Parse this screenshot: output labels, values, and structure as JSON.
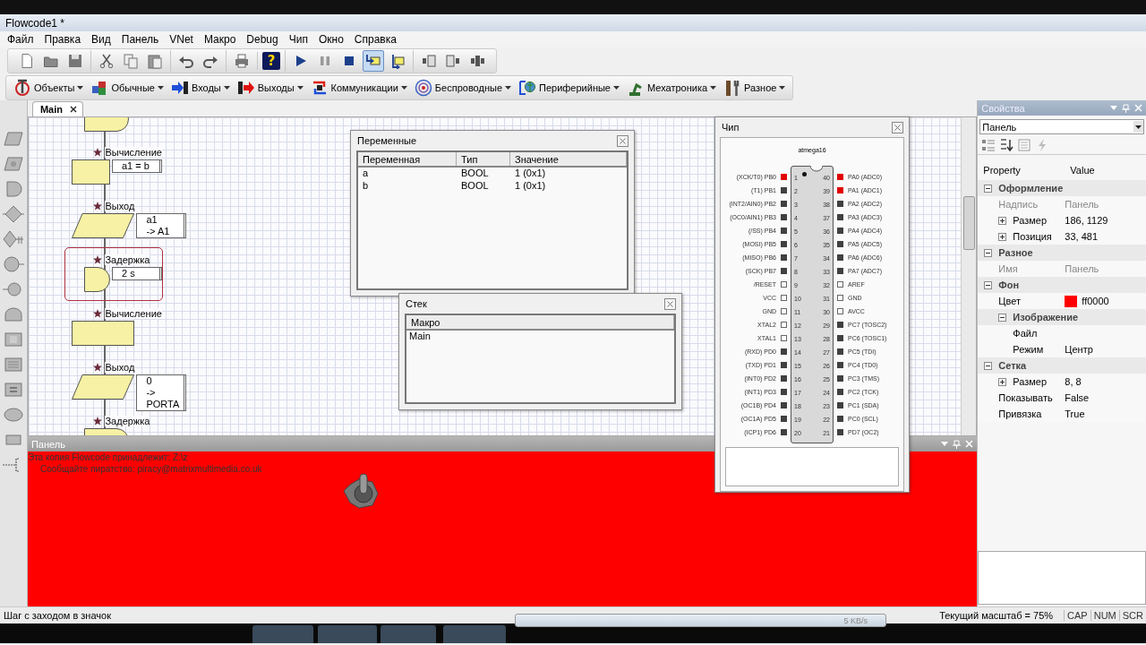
{
  "window": {
    "title": "Flowcode1 *"
  },
  "menu": [
    "Файл",
    "Правка",
    "Вид",
    "Панель",
    "VNet",
    "Макро",
    "Debug",
    "Чип",
    "Окно",
    "Справка"
  ],
  "toolbar": [
    [
      {
        "kind": "new",
        "pressed": false
      },
      {
        "kind": "open",
        "pressed": false
      },
      {
        "kind": "save",
        "pressed": false
      }
    ],
    [
      {
        "kind": "cut",
        "pressed": false
      },
      {
        "kind": "copy",
        "pressed": false
      },
      {
        "kind": "paste",
        "pressed": false
      }
    ],
    [
      {
        "kind": "undo",
        "pressed": false
      },
      {
        "kind": "redo",
        "pressed": false
      }
    ],
    [
      {
        "kind": "print",
        "pressed": false
      }
    ],
    [
      {
        "kind": "help",
        "label": "?",
        "pressed": false
      }
    ],
    [
      {
        "kind": "play",
        "pressed": false
      },
      {
        "kind": "pause",
        "pressed": false
      },
      {
        "kind": "stop",
        "pressed": false
      },
      {
        "kind": "step-into",
        "pressed": true
      },
      {
        "kind": "step-over",
        "pressed": false
      }
    ],
    [
      {
        "kind": "watch-c",
        "pressed": false
      },
      {
        "kind": "watch-b",
        "pressed": false
      },
      {
        "kind": "watch-x",
        "pressed": false
      }
    ]
  ],
  "components": [
    {
      "kind": "objects",
      "label": "Объекты"
    },
    {
      "kind": "common",
      "label": "Обычные"
    },
    {
      "kind": "inputs",
      "label": "Входы"
    },
    {
      "kind": "outputs",
      "label": "Выходы"
    },
    {
      "kind": "comms",
      "label": "Коммуникации"
    },
    {
      "kind": "wireless",
      "label": "Беспроводные"
    },
    {
      "kind": "peripheral",
      "label": "Периферийные"
    },
    {
      "kind": "mechatronics",
      "label": "Мехатроника"
    },
    {
      "kind": "misc",
      "label": "Разное"
    }
  ],
  "tab": {
    "label": "Main"
  },
  "flowchart": [
    {
      "kind": "delay"
    },
    {
      "kind": "calc",
      "label": "Вычисление",
      "param": [
        "a1 = b"
      ],
      "selected": false
    },
    {
      "kind": "output",
      "label": "Выход",
      "param": [
        "a1",
        "-> A1"
      ],
      "selected": false
    },
    {
      "kind": "delay",
      "label": "Задержка",
      "param": [
        "2 s"
      ],
      "selected": true
    },
    {
      "kind": "calc",
      "label": "Вычисление",
      "selected": false
    },
    {
      "kind": "output",
      "label": "Выход",
      "param": [
        "0",
        "-> PORTA"
      ],
      "selected": false
    },
    {
      "kind": "delay",
      "label": "Задержка",
      "selected": false
    }
  ],
  "variables_window": {
    "title": "Переменные",
    "columns": [
      "Переменная",
      "Тип",
      "Значение"
    ],
    "rows": [
      [
        "a",
        "BOOL",
        "1 (0x1)"
      ],
      [
        "b",
        "BOOL",
        "1 (0x1)"
      ]
    ]
  },
  "stack_window": {
    "title": "Стек",
    "column": "Макро",
    "rows": [
      "Main"
    ]
  },
  "chip_window": {
    "title": "Чип",
    "chip": "atmega16",
    "left_pins": [
      {
        "number": "1",
        "label": "(XCK/T0) PB0",
        "kind": "io",
        "high": true
      },
      {
        "number": "2",
        "label": "(T1) PB1",
        "kind": "io",
        "high": false
      },
      {
        "number": "3",
        "label": "(INT2/AIN0) PB2",
        "kind": "io",
        "high": false
      },
      {
        "number": "4",
        "label": "(OC0/AIN1) PB3",
        "kind": "io",
        "high": false
      },
      {
        "number": "5",
        "label": "(/SS) PB4",
        "kind": "io",
        "high": false
      },
      {
        "number": "6",
        "label": "(MOSI) PB5",
        "kind": "io",
        "high": false
      },
      {
        "number": "7",
        "label": "(MISO) PB6",
        "kind": "io",
        "high": false
      },
      {
        "number": "8",
        "label": "(SCK) PB7",
        "kind": "io",
        "high": false
      },
      {
        "number": "9",
        "label": "/RESET",
        "kind": "power"
      },
      {
        "number": "10",
        "label": "VCC",
        "kind": "power"
      },
      {
        "number": "11",
        "label": "GND",
        "kind": "power"
      },
      {
        "number": "12",
        "label": "XTAL2",
        "kind": "power"
      },
      {
        "number": "13",
        "label": "XTAL1",
        "kind": "power"
      },
      {
        "number": "14",
        "label": "(RXD) PD0",
        "kind": "io",
        "high": false
      },
      {
        "number": "15",
        "label": "(TXD) PD1",
        "kind": "io",
        "high": false
      },
      {
        "number": "16",
        "label": "(INT0) PD2",
        "kind": "io",
        "high": false
      },
      {
        "number": "17",
        "label": "(INT1) PD3",
        "kind": "io",
        "high": false
      },
      {
        "number": "18",
        "label": "(OC1B) PD4",
        "kind": "io",
        "high": false
      },
      {
        "number": "19",
        "label": "(OC1A) PD5",
        "kind": "io",
        "high": false
      },
      {
        "number": "20",
        "label": "(ICP1) PD6",
        "kind": "io",
        "high": false
      }
    ],
    "right_pins": [
      {
        "number": "40",
        "label": "PA0 (ADC0)",
        "kind": "io",
        "high": true
      },
      {
        "number": "39",
        "label": "PA1 (ADC1)",
        "kind": "io",
        "high": true
      },
      {
        "number": "38",
        "label": "PA2 (ADC2)",
        "kind": "io",
        "high": false
      },
      {
        "number": "37",
        "label": "PA3 (ADC3)",
        "kind": "io",
        "high": false
      },
      {
        "number": "36",
        "label": "PA4 (ADC4)",
        "kind": "io",
        "high": false
      },
      {
        "number": "35",
        "label": "PA5 (ADC5)",
        "kind": "io",
        "high": false
      },
      {
        "number": "34",
        "label": "PA6 (ADC6)",
        "kind": "io",
        "high": false
      },
      {
        "number": "33",
        "label": "PA7 (ADC7)",
        "kind": "io",
        "high": false
      },
      {
        "number": "32",
        "label": "AREF",
        "kind": "power"
      },
      {
        "number": "31",
        "label": "GND",
        "kind": "power"
      },
      {
        "number": "30",
        "label": "AVCC",
        "kind": "power"
      },
      {
        "number": "29",
        "label": "PC7 (TOSC2)",
        "kind": "io",
        "high": false
      },
      {
        "number": "28",
        "label": "PC6 (TOSC1)",
        "kind": "io",
        "high": false
      },
      {
        "number": "27",
        "label": "PC5 (TDI)",
        "kind": "io",
        "high": false
      },
      {
        "number": "26",
        "label": "PC4 (TD0)",
        "kind": "io",
        "high": false
      },
      {
        "number": "25",
        "label": "PC3 (TMS)",
        "kind": "io",
        "high": false
      },
      {
        "number": "24",
        "label": "PC2 (TCK)",
        "kind": "io",
        "high": false
      },
      {
        "number": "23",
        "label": "PC1 (SDA)",
        "kind": "io",
        "high": false
      },
      {
        "number": "22",
        "label": "PC0 (SCL)",
        "kind": "io",
        "high": false
      },
      {
        "number": "21",
        "label": "PD7 (OC2)",
        "kind": "io",
        "high": false
      }
    ]
  },
  "panel": {
    "title": "Панель",
    "lines": [
      "Эта копия Flowcode принадлежит: Z:\\z",
      "Сообщайте пиратство: piracy@matrixmultimedia.co.uk"
    ]
  },
  "properties": {
    "title": "Свойства",
    "object": "Панель",
    "columns": [
      "Property",
      "Value"
    ],
    "items": [
      {
        "name": "Оформление",
        "expanded": true,
        "children": [
          {
            "name": "Надпись",
            "value": "Панель",
            "disabled": true
          },
          {
            "name": "Размер",
            "value": "186, 1129",
            "expanded": false,
            "disabled": false
          },
          {
            "name": "Позиция",
            "value": "33, 481",
            "expanded": false,
            "disabled": false
          }
        ]
      },
      {
        "name": "Разное",
        "expanded": true,
        "children": [
          {
            "name": "Имя",
            "value": "Панель",
            "disabled": true
          }
        ]
      },
      {
        "name": "Фон",
        "expanded": true,
        "children": [
          {
            "name": "Цвет",
            "value": "ff0000",
            "color": "#ff0000",
            "disabled": false
          },
          {
            "name": "Изображение",
            "expanded": true,
            "children": [
              {
                "name": "Файл",
                "disabled": false
              },
              {
                "name": "Режим",
                "value": "Центр",
                "disabled": false
              }
            ]
          }
        ]
      },
      {
        "name": "Сетка",
        "expanded": true,
        "children": [
          {
            "name": "Размер",
            "value": "8, 8",
            "expanded": false,
            "disabled": false
          },
          {
            "name": "Показывать",
            "value": "False",
            "disabled": false
          },
          {
            "name": "Привязка",
            "value": "True",
            "disabled": false
          }
        ]
      }
    ]
  },
  "status_bar": {
    "message": "Шаг с заходом в значок",
    "zoom": "Текущий масштаб = 75%",
    "indicators": [
      "CAP",
      "NUM",
      "SCR"
    ],
    "transfer": "5 KB/s"
  }
}
